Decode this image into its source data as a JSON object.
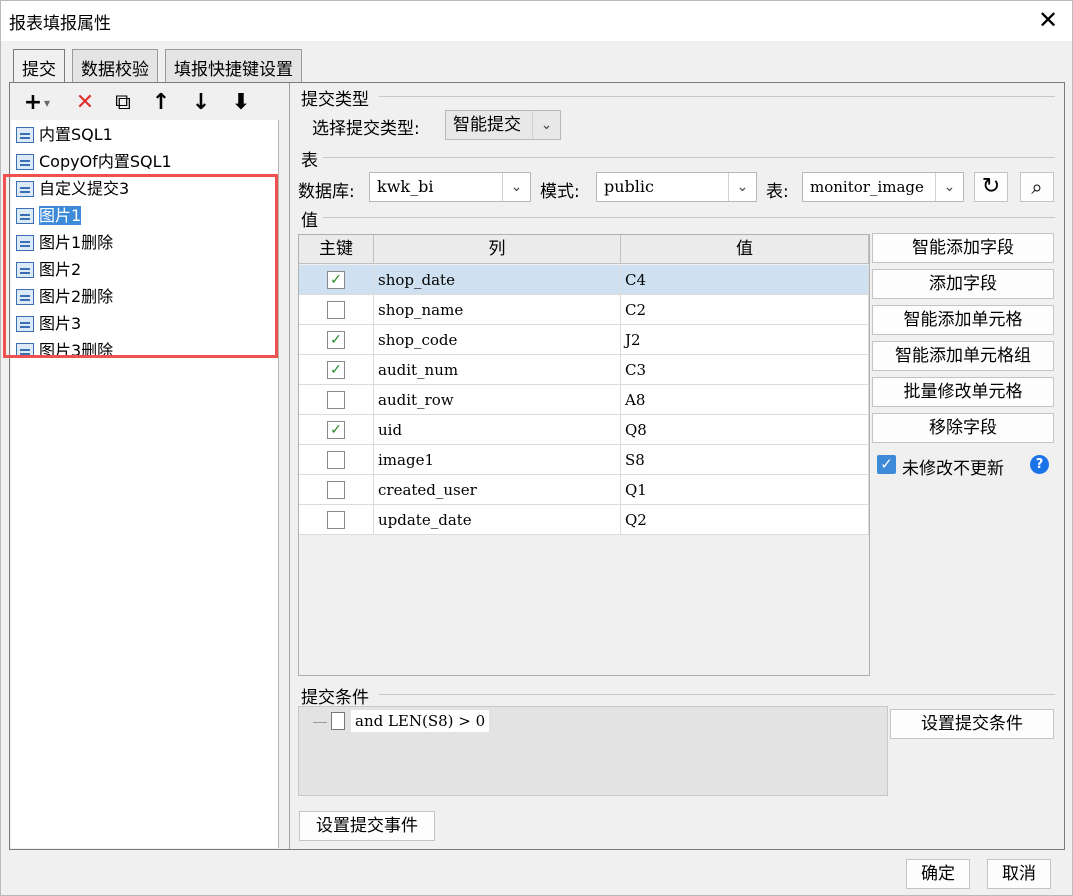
{
  "window": {
    "title": "报表填报属性",
    "close_glyph": "✕"
  },
  "tabs": [
    {
      "label": "提交",
      "active": true
    },
    {
      "label": "数据校验",
      "active": false
    },
    {
      "label": "填报快捷键设置",
      "active": false
    }
  ],
  "toolbar": {
    "add": "+",
    "add_caret": "▾",
    "delete": "✕",
    "copy": "⧉",
    "up": "↑",
    "down": "↓",
    "bottom": "⬇"
  },
  "tree": {
    "items": [
      {
        "label": "内置SQL1",
        "selected": false
      },
      {
        "label": "CopyOf内置SQL1",
        "selected": false
      },
      {
        "label": "自定义提交3",
        "selected": false
      },
      {
        "label": "图片1",
        "selected": true
      },
      {
        "label": "图片1删除",
        "selected": false
      },
      {
        "label": "图片2",
        "selected": false
      },
      {
        "label": "图片2删除",
        "selected": false
      },
      {
        "label": "图片3",
        "selected": false
      },
      {
        "label": "图片3删除",
        "selected": false
      }
    ]
  },
  "submit_type": {
    "section": "提交类型",
    "label": "选择提交类型:",
    "value": "智能提交",
    "arrow": "⌄"
  },
  "table_section": {
    "section": "表",
    "db_label": "数据库:",
    "db_value": "kwk_bi",
    "schema_label": "模式:",
    "schema_value": "public",
    "table_label": "表:",
    "table_value": "monitor_image",
    "refresh": "↻",
    "preview": "⌕",
    "arrow": "⌄"
  },
  "values": {
    "section": "值",
    "headers": [
      "主键",
      "列",
      "值"
    ],
    "rows": [
      {
        "key": true,
        "col": "shop_date",
        "val": "C4"
      },
      {
        "key": false,
        "col": "shop_name",
        "val": "C2"
      },
      {
        "key": true,
        "col": "shop_code",
        "val": "J2"
      },
      {
        "key": true,
        "col": "audit_num",
        "val": "C3"
      },
      {
        "key": false,
        "col": "audit_row",
        "val": "A8"
      },
      {
        "key": true,
        "col": "uid",
        "val": "Q8"
      },
      {
        "key": false,
        "col": "image1",
        "val": "S8"
      },
      {
        "key": false,
        "col": "created_user",
        "val": "Q1"
      },
      {
        "key": false,
        "col": "update_date",
        "val": "Q2"
      }
    ],
    "check_glyph": "✓"
  },
  "side_buttons": [
    "智能添加字段",
    "添加字段",
    "智能添加单元格",
    "智能添加单元格组",
    "批量修改单元格",
    "移除字段"
  ],
  "no_update": {
    "label": "未修改不更新",
    "checked": true,
    "check_glyph": "✓",
    "help": "?"
  },
  "condition": {
    "section": "提交条件",
    "value": "and LEN(S8) > 0",
    "button": "设置提交条件"
  },
  "event_button": "设置提交事件",
  "footer": {
    "ok": "确定",
    "cancel": "取消"
  },
  "colors": {
    "accent": "#3d8ad9",
    "highlight_box": "#f05050",
    "check_green": "#2c8a2c",
    "help_blue": "#1a73e8"
  }
}
